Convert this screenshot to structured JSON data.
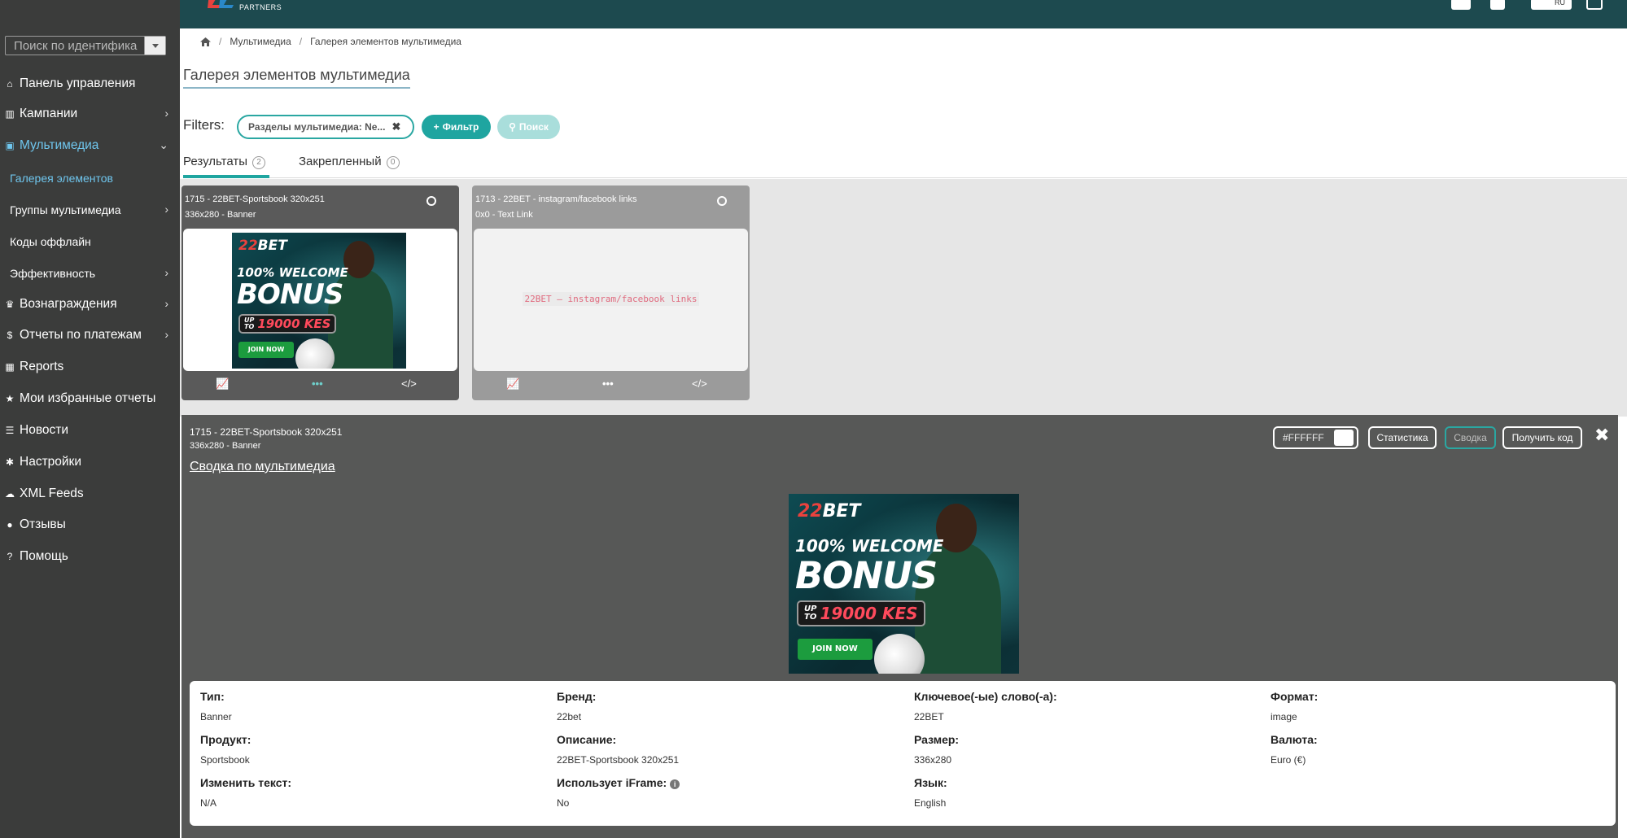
{
  "sidebar": {
    "search_placeholder": "Поиск по идентифика",
    "items": [
      {
        "label": "Панель управления",
        "icon": "home-icon",
        "glyph": "⌂"
      },
      {
        "label": "Кампании",
        "icon": "bar-chart-icon",
        "glyph": "▥"
      },
      {
        "label": "Мультимедиа",
        "icon": "image-icon",
        "glyph": "▣"
      },
      {
        "label": "Галерея элементов"
      },
      {
        "label": "Группы мультимедиа"
      },
      {
        "label": "Коды оффлайн"
      },
      {
        "label": "Эффективность"
      },
      {
        "label": "Вознаграждения",
        "icon": "trophy-icon",
        "glyph": "♛"
      },
      {
        "label": "Отчеты по платежам",
        "icon": "dollar-icon",
        "glyph": "$"
      },
      {
        "label": "Reports",
        "icon": "table-icon",
        "glyph": "▦"
      },
      {
        "label": "Мои избранные отчеты",
        "icon": "star-icon",
        "glyph": "★"
      },
      {
        "label": "Новости",
        "icon": "list-icon",
        "glyph": "☰"
      },
      {
        "label": "Настройки",
        "icon": "gear-icon",
        "glyph": "✱"
      },
      {
        "label": "XML Feeds",
        "icon": "cloud-icon",
        "glyph": "☁"
      },
      {
        "label": "Отзывы",
        "icon": "comment-icon",
        "glyph": "●"
      },
      {
        "label": "Помощь",
        "icon": "help-icon",
        "glyph": "?"
      }
    ]
  },
  "topbar": {
    "logo_text": "PARTNERS",
    "lang": "RU"
  },
  "breadcrumb": {
    "home_icon": "home-icon",
    "items": [
      "Мультимедиа",
      "Галерея элементов мультимедиа"
    ]
  },
  "page": {
    "title": "Галерея элементов мультимедиа",
    "filters_label": "Filters:",
    "filter_chip": "Разделы мультимедиа: Ne...",
    "filter_button": "Фильтр",
    "search_button": "Поиск"
  },
  "tabs": [
    {
      "label": "Результаты",
      "count": "2"
    },
    {
      "label": "Закрепленный",
      "count": "0"
    }
  ],
  "cards": [
    {
      "title": "1715 - 22BET-Sportsbook 320x251",
      "subtitle": "336x280 - Banner"
    },
    {
      "title": "1713 - 22BET - instagram/facebook links",
      "subtitle": "0x0 - Text Link",
      "text_link": "22BET – instagram/facebook links"
    }
  ],
  "card_actions": {
    "stats": "stats-icon",
    "more": "more-icon",
    "code": "code-icon"
  },
  "banner": {
    "logo_twos": "22",
    "logo_bet": "BET",
    "line1": "100% WELCOME",
    "line2": "BONUS",
    "upto_a": "UP",
    "upto_b": "TO",
    "amount": "19000 KES",
    "join": "JOIN NOW"
  },
  "detail": {
    "title": "1715 - 22BET-Sportsbook 320x251",
    "subtitle": "336x280 - Banner",
    "summary_link": "Сводка по мультимедиа",
    "color_value": "#FFFFFF",
    "btn_stats": "Статистика",
    "btn_summary": "Сводка",
    "btn_getcode": "Получить код",
    "close": "✖"
  },
  "info": {
    "type_label": "Тип:",
    "type_value": "Banner",
    "brand_label": "Бренд:",
    "brand_value": "22bet",
    "keywords_label": "Ключевое(-ые) слово(-а):",
    "keywords_value": "22BET",
    "format_label": "Формат:",
    "format_value": "image",
    "product_label": "Продукт:",
    "product_value": "Sportsbook",
    "desc_label": "Описание:",
    "desc_value": "22BET-Sportsbook 320x251",
    "size_label": "Размер:",
    "size_value": "336x280",
    "currency_label": "Валюта:",
    "currency_value": "Euro (€)",
    "edittext_label": "Изменить текст:",
    "edittext_value": "N/A",
    "iframe_label": "Использует iFrame:",
    "iframe_value": "No",
    "lang_label": "Язык:",
    "lang_value": "English"
  },
  "colors": {
    "accent": "#1fa5a0",
    "sidebar": "#3b3c3b",
    "topbar": "#1d4a4f",
    "active_nav": "#6fc6ee"
  }
}
